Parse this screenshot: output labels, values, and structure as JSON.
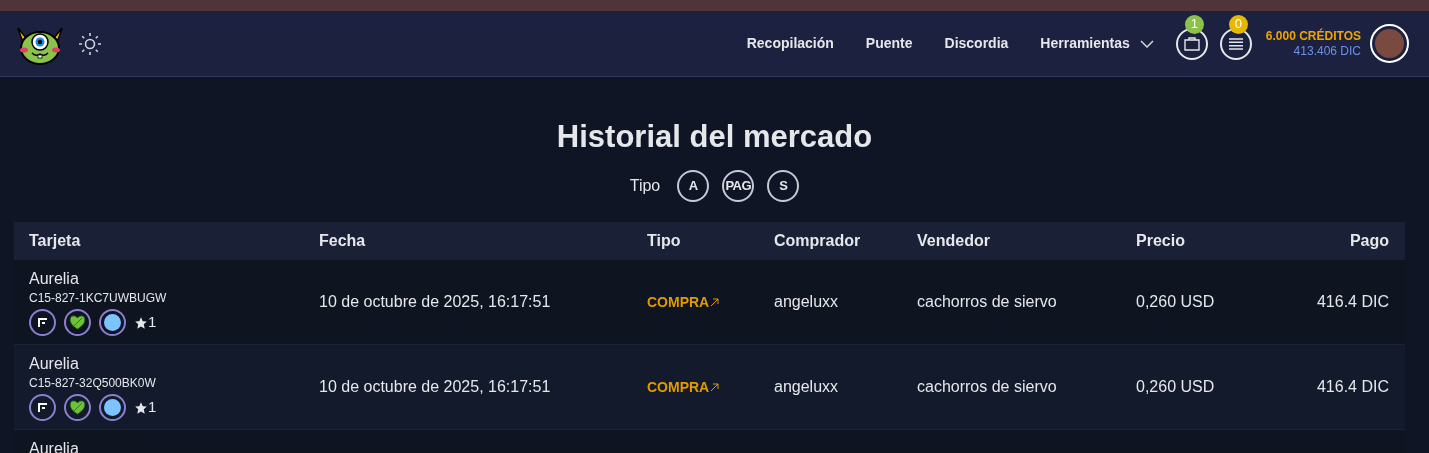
{
  "nav": {
    "links": [
      "Recopilación",
      "Puente",
      "Discordia",
      "Herramientas"
    ],
    "badges": [
      {
        "kind": "bag",
        "count": "1",
        "color": "#8bc34a"
      },
      {
        "kind": "list",
        "count": "0",
        "color": "#e6b800"
      }
    ],
    "credits": "6.000 CRÉDITOS",
    "balance": "413.406 DIC"
  },
  "title": "Historial del mercado",
  "filter": {
    "label": "Tipo",
    "options": [
      "A",
      "PAG",
      "S"
    ]
  },
  "table": {
    "columns": [
      "Tarjeta",
      "Fecha",
      "Tipo",
      "Comprador",
      "Vendedor",
      "Precio",
      "Pago"
    ],
    "rows": [
      {
        "card": "Aurelia",
        "code": "C15-827-1KC7UWBUGW",
        "star_count": "1",
        "date": "10 de octubre de 2025, 16:17:51",
        "type": "COMPRA",
        "buyer": "angeluxx",
        "seller": "cachorros de siervo",
        "price": "0,260 USD",
        "payment": "416.4 DIC"
      },
      {
        "card": "Aurelia",
        "code": "C15-827-32Q500BK0W",
        "star_count": "1",
        "date": "10 de octubre de 2025, 16:17:51",
        "type": "COMPRA",
        "buyer": "angeluxx",
        "seller": "cachorros de siervo",
        "price": "0,260 USD",
        "payment": "416.4 DIC"
      },
      {
        "card": "Aurelia"
      }
    ]
  }
}
